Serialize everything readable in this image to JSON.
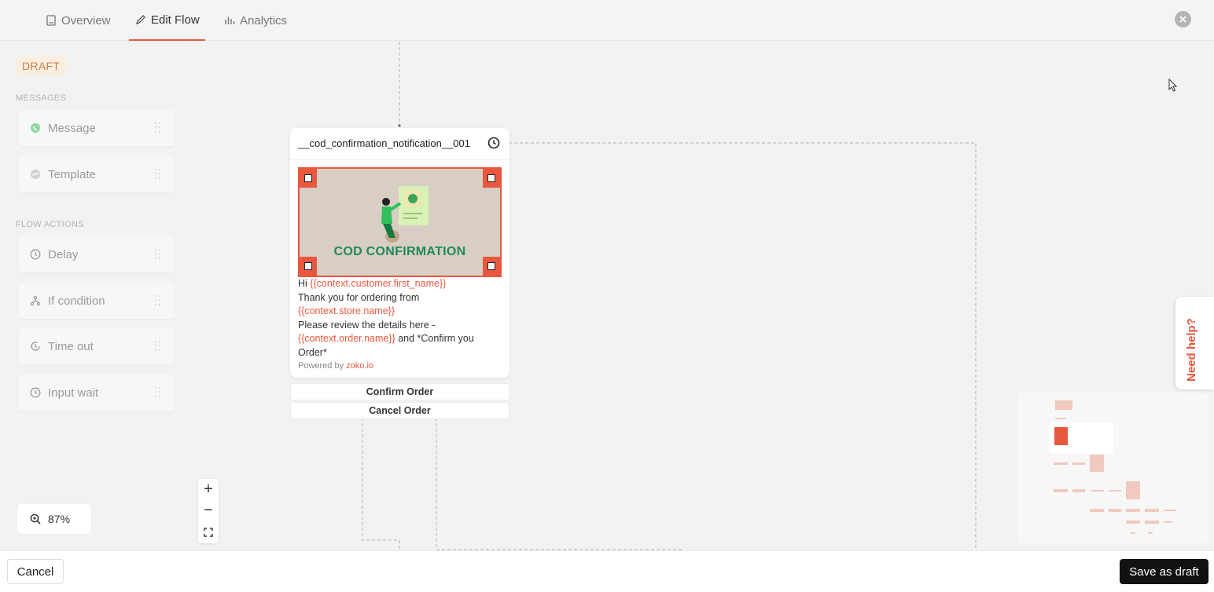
{
  "tabs": [
    {
      "label": "Overview",
      "icon": "book-icon"
    },
    {
      "label": "Edit Flow",
      "icon": "pencil-icon",
      "active": true
    },
    {
      "label": "Analytics",
      "icon": "bar-chart-icon"
    }
  ],
  "status_badge": "DRAFT",
  "sidebar": {
    "messages_label": "MESSAGES",
    "messages": [
      {
        "label": "Message",
        "icon": "whatsapp-icon"
      },
      {
        "label": "Template",
        "icon": "messenger-icon"
      }
    ],
    "flow_actions_label": "FLOW ACTIONS",
    "flow_actions": [
      {
        "label": "Delay",
        "icon": "clock-icon"
      },
      {
        "label": "If condition",
        "icon": "branch-icon"
      },
      {
        "label": "Time out",
        "icon": "timeout-icon"
      },
      {
        "label": "Input wait",
        "icon": "clock-icon"
      }
    ]
  },
  "node": {
    "title": "__cod_confirmation_notification__001",
    "banner_text": "COD CONFIRMATION",
    "message": {
      "greeting": "Hi ",
      "var_first_name": "{{context.customer.first_name}}",
      "thanks": "Thank you for ordering from",
      "var_store": "{{context.store.name}}",
      "review": "Please review the details here -",
      "var_order": "{{context.order.name}}",
      "confirm_text": " and *Confirm you Order*"
    },
    "powered_by": "Powered by ",
    "powered_link": "zoko.io",
    "buttons": [
      "Confirm Order",
      "Cancel Order"
    ]
  },
  "zoom": {
    "level": "87%",
    "plus": "+",
    "minus": "−"
  },
  "help_label": "Need help?",
  "footer": {
    "cancel": "Cancel",
    "save": "Save as draft"
  },
  "colors": {
    "accent": "#e9573f",
    "banner_green": "#1e8a5a",
    "draft_bg": "#fbeee0"
  }
}
